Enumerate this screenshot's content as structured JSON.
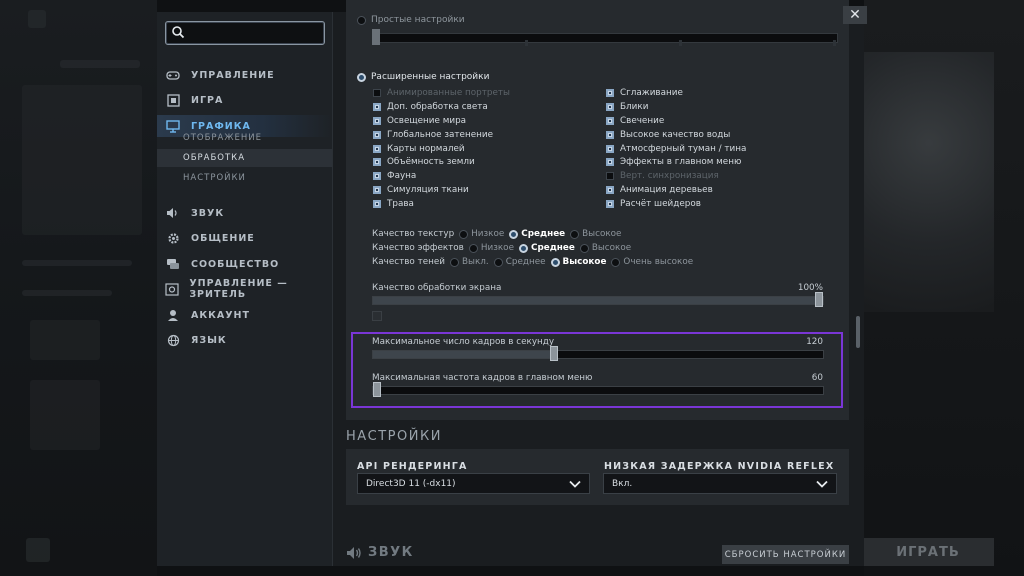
{
  "search": {
    "placeholder": "",
    "value": ""
  },
  "close_glyph": "✕",
  "sidebar": {
    "items": [
      {
        "label": "УПРАВЛЕНИЕ",
        "icon": "gamepad-icon"
      },
      {
        "label": "ИГРА",
        "icon": "game-icon"
      },
      {
        "label": "ГРАФИКА",
        "icon": "monitor-icon",
        "active": true
      },
      {
        "label": "ЗВУК",
        "icon": "speaker-icon"
      },
      {
        "label": "ОБЩЕНИЕ",
        "icon": "gear-icon"
      },
      {
        "label": "СООБЩЕСТВО",
        "icon": "chat-icon"
      },
      {
        "label": "УПРАВЛЕНИЕ — ЗРИТЕЛЬ",
        "icon": "spectator-icon"
      },
      {
        "label": "АККАУНТ",
        "icon": "user-icon"
      },
      {
        "label": "ЯЗЫК",
        "icon": "globe-icon"
      }
    ],
    "sub_items": [
      {
        "label": "ОТОБРАЖЕНИЕ"
      },
      {
        "label": "ОБРАБОТКА",
        "active": true
      },
      {
        "label": "НАСТРОЙКИ"
      }
    ]
  },
  "graphics": {
    "simple_label": "Простые настройки",
    "advanced_label": "Расширенные настройки",
    "left_checks": [
      {
        "label": "Анимированные портреты",
        "checked": false,
        "dim": true
      },
      {
        "label": "Доп. обработка света",
        "checked": true
      },
      {
        "label": "Освещение мира",
        "checked": true
      },
      {
        "label": "Глобальное затенение",
        "checked": true
      },
      {
        "label": "Карты нормалей",
        "checked": true
      },
      {
        "label": "Объёмность земли",
        "checked": true
      },
      {
        "label": "Фауна",
        "checked": true
      },
      {
        "label": "Симуляция ткани",
        "checked": true
      },
      {
        "label": "Трава",
        "checked": true
      }
    ],
    "right_checks": [
      {
        "label": "Сглаживание",
        "checked": true
      },
      {
        "label": "Блики",
        "checked": true
      },
      {
        "label": "Свечение",
        "checked": true
      },
      {
        "label": "Высокое качество воды",
        "checked": true
      },
      {
        "label": "Атмосферный туман / тина",
        "checked": true
      },
      {
        "label": "Эффекты в главном меню",
        "checked": true
      },
      {
        "label": "Верт. синхронизация",
        "checked": false,
        "dim": true
      },
      {
        "label": "Анимация деревьев",
        "checked": true
      },
      {
        "label": "Расчёт шейдеров",
        "checked": true
      }
    ],
    "texture_quality": {
      "label": "Качество текстур",
      "options": [
        "Низкое",
        "Среднее",
        "Высокое"
      ],
      "selected": 1
    },
    "effects_quality": {
      "label": "Качество эффектов",
      "options": [
        "Низкое",
        "Среднее",
        "Высокое"
      ],
      "selected": 1
    },
    "shadow_quality": {
      "label": "Качество теней",
      "options": [
        "Выкл.",
        "Среднее",
        "Высокое",
        "Очень высокое"
      ],
      "selected": 2
    },
    "screen_quality": {
      "label": "Качество обработки экрана",
      "value_text": "100%",
      "fraction": 1.0
    },
    "max_fps": {
      "label": "Максимальное число кадров в секунду",
      "value_text": "120",
      "fraction": 0.4
    },
    "max_menu_fps": {
      "label": "Максимальная частота кадров в главном меню",
      "value_text": "60",
      "fraction": 0.0
    }
  },
  "settings": {
    "title": "НАСТРОЙКИ",
    "api_label": "API РЕНДЕРИНГА",
    "api_value": "Direct3D 11 (-dx11)",
    "reflex_label": "НИЗКАЯ ЗАДЕРЖКА NVIDIA REFLEX",
    "reflex_value": "Вкл."
  },
  "footer": {
    "section": "ЗВУК",
    "reset_label": "СБРОСИТЬ НАСТРОЙКИ",
    "play_label": "ИГРАТЬ"
  }
}
